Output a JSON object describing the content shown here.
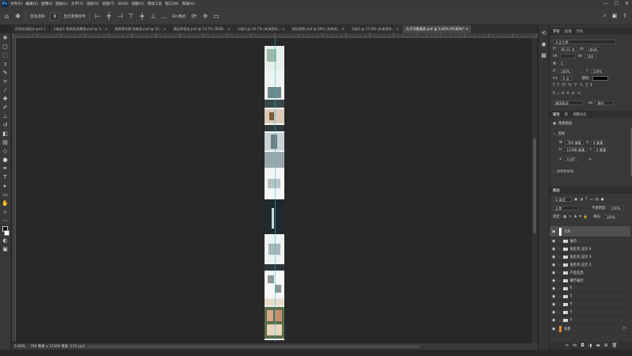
{
  "app": {
    "logo": "Ps"
  },
  "menu": [
    "文件(F)",
    "编辑(E)",
    "图像(I)",
    "图层(L)",
    "文字(Y)",
    "选择(S)",
    "滤镜(T)",
    "3D(D)",
    "视图(V)",
    "增效工具",
    "窗口(W)",
    "帮助(H)"
  ],
  "window_controls": [
    "—",
    "☐",
    "✕"
  ],
  "options": {
    "autoselect_label": "自动选择:",
    "autoselect_value": "组",
    "show_transform": "显示变换控件",
    "mode_3d": "3D 模式:"
  },
  "tabs": [
    {
      "label": "尼哈达成设计.psd ×"
    },
    {
      "label": "卡航@1-张新台场景图.psd @ 3... ×"
    },
    {
      "label": "规章原内容-张新台.psd @ 25... ×"
    },
    {
      "label": "满足四场合.psd @ 13.7% (RGB/... ×"
    },
    {
      "label": "卡航2 @ 16.7% (未来资料... ×"
    },
    {
      "label": "保证原质.psd @ 26% (未来设... ×"
    },
    {
      "label": "卡航2 @ 17.8% (未来资料... ×"
    },
    {
      "label": "丸子详细描述.psd @ 5.83% (RGB/8)* ×",
      "active": true
    }
  ],
  "status": {
    "zoom": "5.83%",
    "info": "790 像素 x 12398 像素 (150 ppi)"
  },
  "char_panel": {
    "tabs": [
      "字符",
      "段落",
      "字形"
    ],
    "font": "方正兰亭",
    "size": "60.31 点",
    "leading": "(自动)",
    "tracking": "0",
    "kerning": "100",
    "scale_v": "100%",
    "scale_h": "100%",
    "baseline": "0 点",
    "color_label": "颜色:",
    "lang": "美国英语",
    "aa": "锐利"
  },
  "props_panel": {
    "tabs": [
      "属性",
      "库",
      "调整动态"
    ],
    "type": "像素图层",
    "transform": "变换",
    "w": "790 像素",
    "h": "12398 像素",
    "x": "0 像素",
    "y": "0 像素",
    "angle": "0.00°",
    "align": "对齐并分布"
  },
  "layers_panel": {
    "title": "图层",
    "kind": "Q 类型",
    "blend": "正常",
    "opacity_label": "不透明度:",
    "opacity": "100%",
    "lock_label": "锁定:",
    "fill_label": "填充:",
    "fill": "100%",
    "layers": [
      {
        "name": "卡片",
        "type": "text",
        "selected": true
      },
      {
        "name": "展示",
        "type": "folder"
      },
      {
        "name": "兔毛毛 设计 4",
        "type": "folder"
      },
      {
        "name": "兔毛毛 设计 3",
        "type": "folder"
      },
      {
        "name": "兔毛毛 设计 2",
        "type": "folder"
      },
      {
        "name": "产品信息",
        "type": "folder"
      },
      {
        "name": "细节展示",
        "type": "folder"
      },
      {
        "name": "6",
        "type": "folder"
      },
      {
        "name": "5",
        "type": "folder"
      },
      {
        "name": "4",
        "type": "folder"
      },
      {
        "name": "3",
        "type": "folder"
      },
      {
        "name": "2",
        "type": "folder"
      },
      {
        "name": "背景",
        "type": "bg"
      }
    ]
  }
}
